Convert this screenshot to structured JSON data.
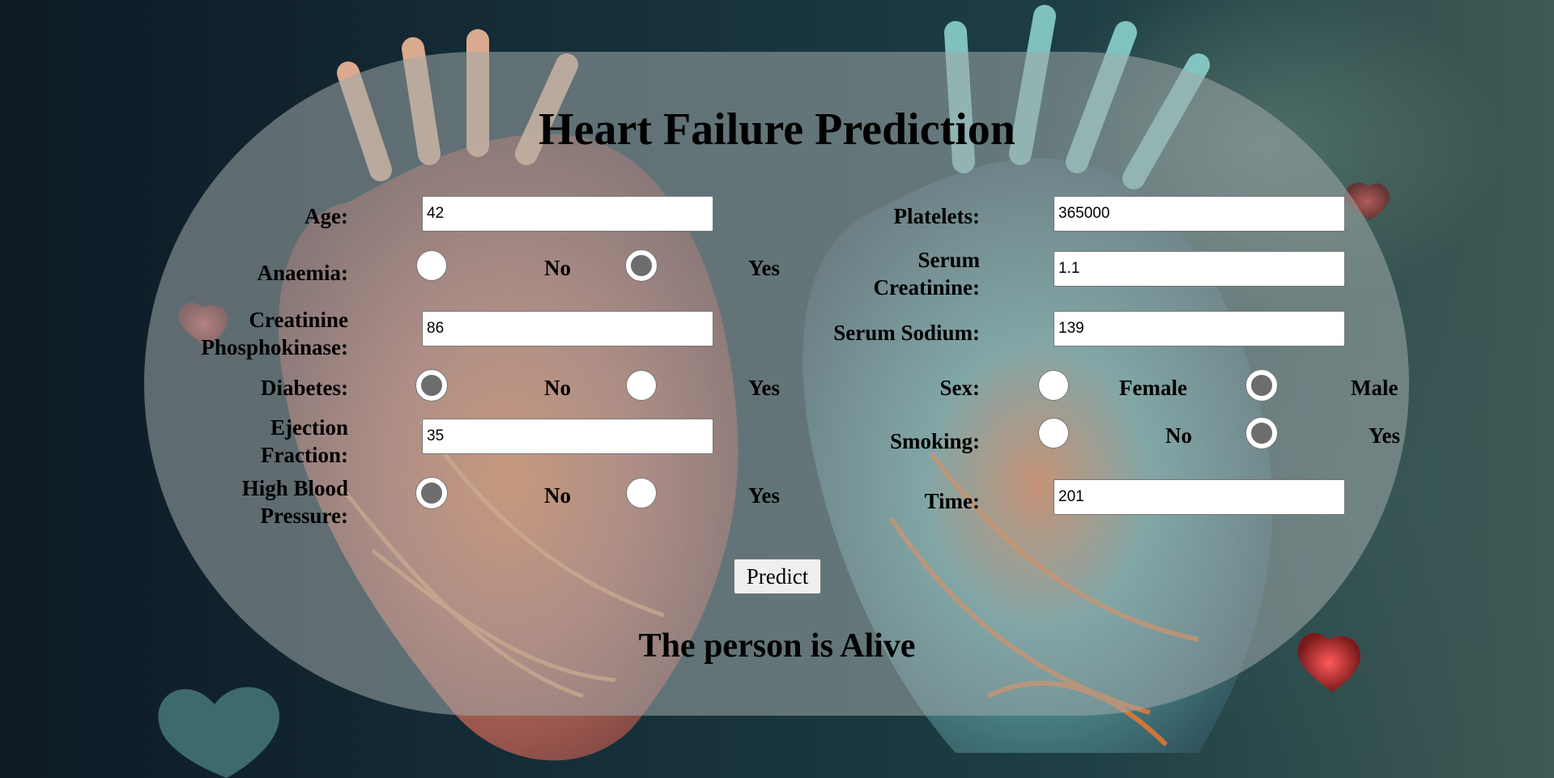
{
  "page": {
    "title": "Heart Failure Prediction",
    "result": "The person is Alive"
  },
  "form": {
    "left": {
      "age": {
        "label": "Age:",
        "value": "42"
      },
      "anaemia": {
        "label": "Anaemia:",
        "options": [
          "No",
          "Yes"
        ],
        "selected": "Yes"
      },
      "creatinine_phosphokinase": {
        "label_line1": "Creatinine",
        "label_line2": "Phosphokinase:",
        "value": "86"
      },
      "diabetes": {
        "label": "Diabetes:",
        "options": [
          "No",
          "Yes"
        ],
        "selected": "No"
      },
      "ejection_fraction": {
        "label_line1": "Ejection",
        "label_line2": "Fraction:",
        "value": "35"
      },
      "high_blood_pressure": {
        "label_line1": "High Blood",
        "label_line2": "Pressure:",
        "options": [
          "No",
          "Yes"
        ],
        "selected": "No"
      }
    },
    "right": {
      "platelets": {
        "label": "Platelets:",
        "value": "365000"
      },
      "serum_creatinine": {
        "label_line1": "Serum",
        "label_line2": "Creatinine:",
        "value": "1.1"
      },
      "serum_sodium": {
        "label": "Serum Sodium:",
        "value": "139"
      },
      "sex": {
        "label": "Sex:",
        "options": [
          "Female",
          "Male"
        ],
        "selected": "Male"
      },
      "smoking": {
        "label": "Smoking:",
        "options": [
          "No",
          "Yes"
        ],
        "selected": "Yes"
      },
      "time": {
        "label": "Time:",
        "value": "201"
      }
    },
    "submit_label": "Predict"
  },
  "colors": {
    "panel": "#a0aaaa",
    "heart_left": "#e07a5a",
    "heart_right": "#6fc2c0",
    "glow": "#ff6a2a"
  }
}
